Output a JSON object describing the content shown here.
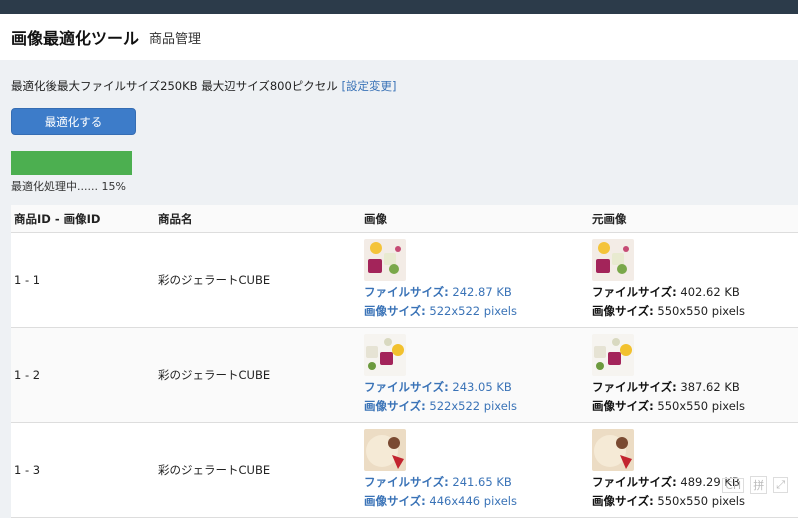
{
  "header": {
    "title": "画像最適化ツール",
    "subtitle": "商品管理"
  },
  "info": {
    "text": "最適化後最大ファイルサイズ250KB 最大辺サイズ800ピクセル ",
    "link": "[設定変更]"
  },
  "button": {
    "label": "最適化する"
  },
  "progress": {
    "percent": 15,
    "text": "最適化処理中...... 15%"
  },
  "table": {
    "headers": [
      "商品ID - 画像ID",
      "商品名",
      "画像",
      "元画像"
    ],
    "file_label": "ファイルサイズ:",
    "size_label": "画像サイズ:",
    "rows": [
      {
        "id": "1 - 1",
        "name": "彩のジェラートCUBE",
        "new_file": "242.87 KB",
        "new_dim": "522x522 pixels",
        "orig_file": "402.62 KB",
        "orig_dim": "550x550 pixels"
      },
      {
        "id": "1 - 2",
        "name": "彩のジェラートCUBE",
        "new_file": "243.05 KB",
        "new_dim": "522x522 pixels",
        "orig_file": "387.62 KB",
        "orig_dim": "550x550 pixels"
      },
      {
        "id": "1 - 3",
        "name": "彩のジェラートCUBE",
        "new_file": "241.65 KB",
        "new_dim": "446x446 pixels",
        "orig_file": "489.29 KB",
        "orig_dim": "550x550 pixels"
      }
    ]
  },
  "ime": {
    "mode": "CH",
    "layout": "拼"
  }
}
